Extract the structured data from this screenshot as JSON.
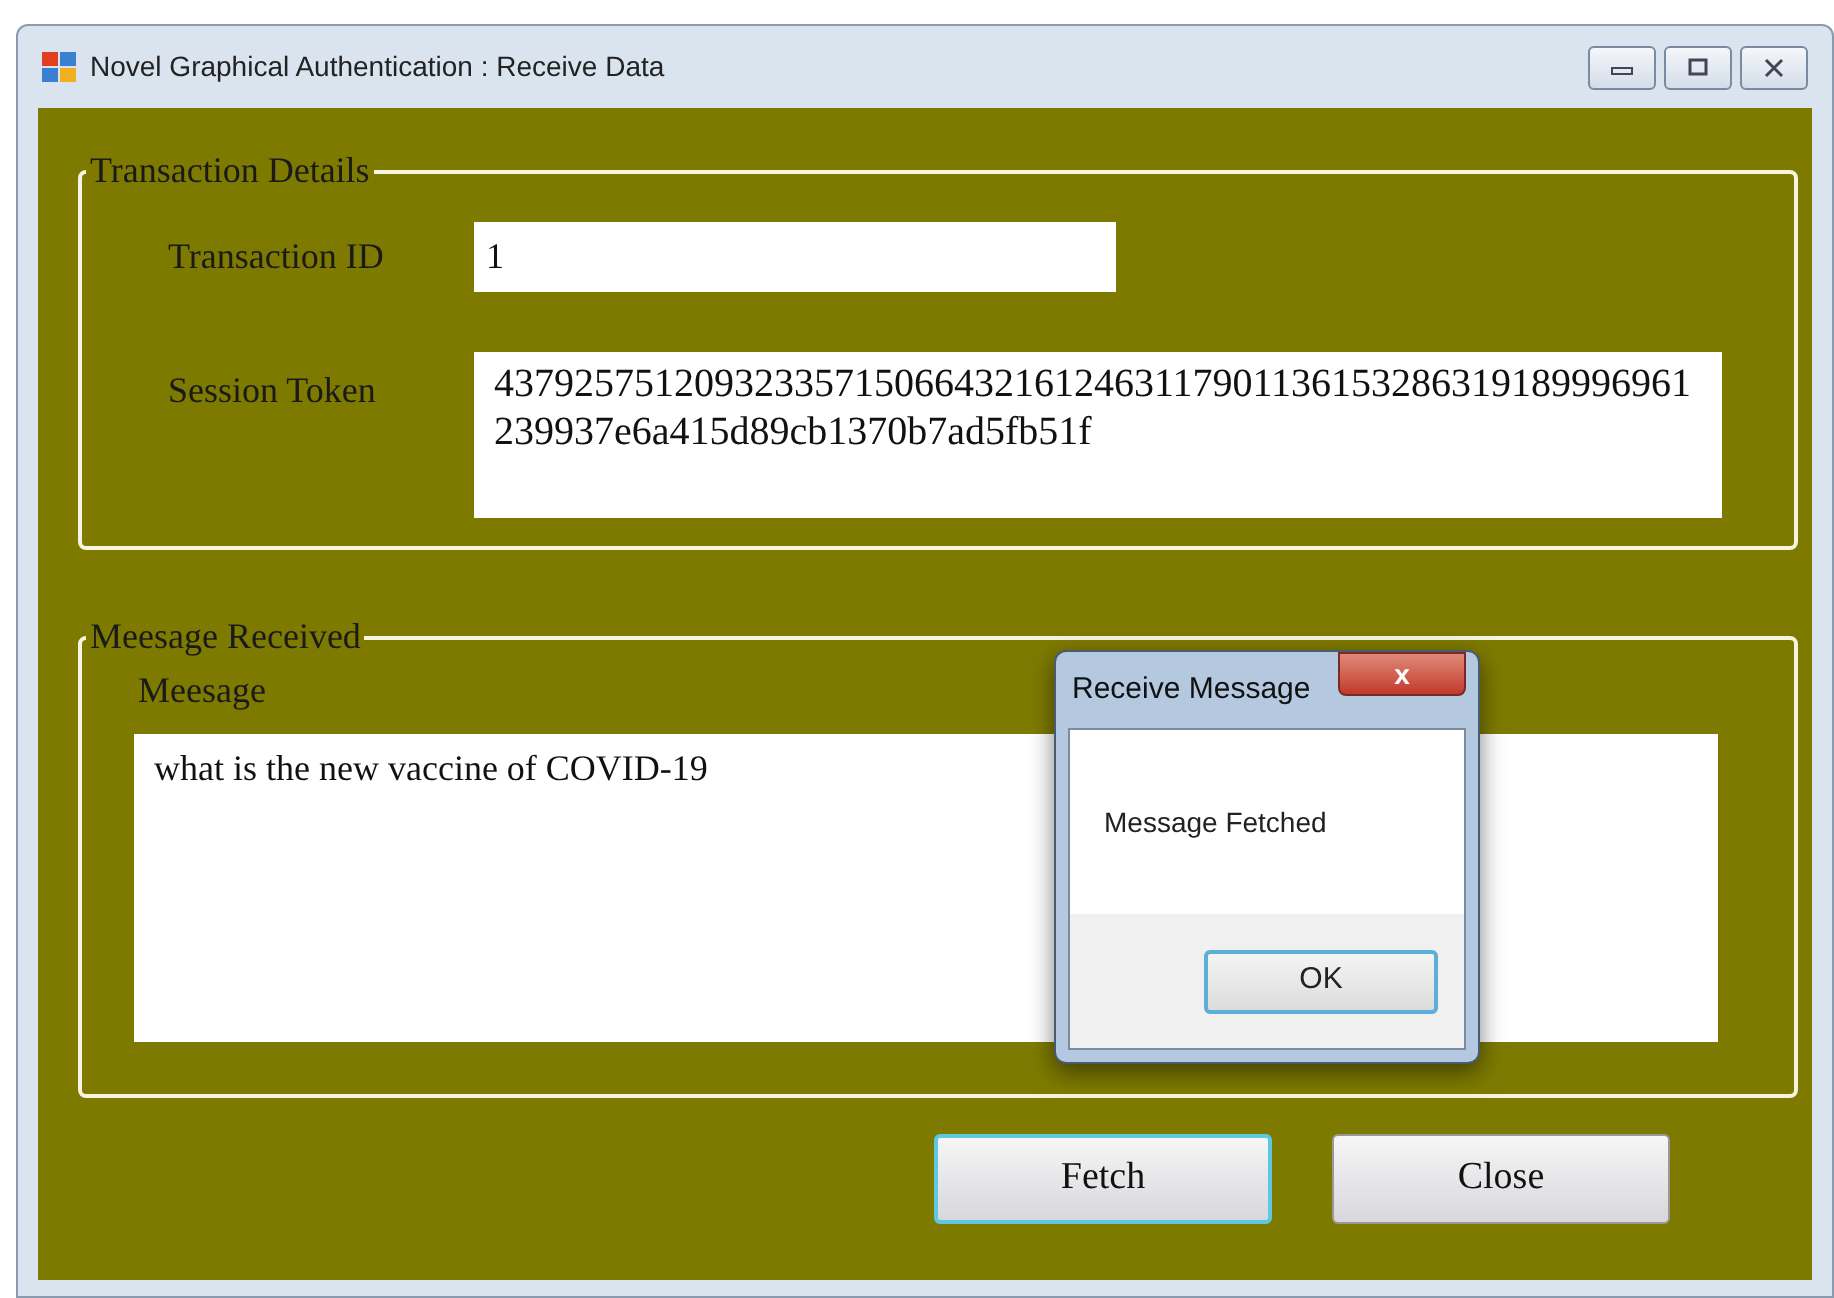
{
  "window": {
    "title": "Novel Graphical Authentication : Receive Data"
  },
  "transaction_details": {
    "title": "Transaction Details",
    "fields": [
      {
        "label": "Transaction ID",
        "value": "1",
        "kind": "line"
      },
      {
        "label": "Session Token",
        "value": "437925751209323357150664321612463117901136153286319189996961239937e6a415d89cb1370b7ad5fb51f",
        "kind": "multiline"
      }
    ]
  },
  "message_received": {
    "title": "Meesage Received",
    "label": "Meesage",
    "value": "what is the new vaccine of COVID-19"
  },
  "buttons": [
    {
      "label": "Fetch",
      "focused": true
    },
    {
      "label": "Close",
      "focused": false
    }
  ],
  "dialog": {
    "title": "Receive Message",
    "close": "x",
    "text": "Message Fetched",
    "button": "OK"
  }
}
